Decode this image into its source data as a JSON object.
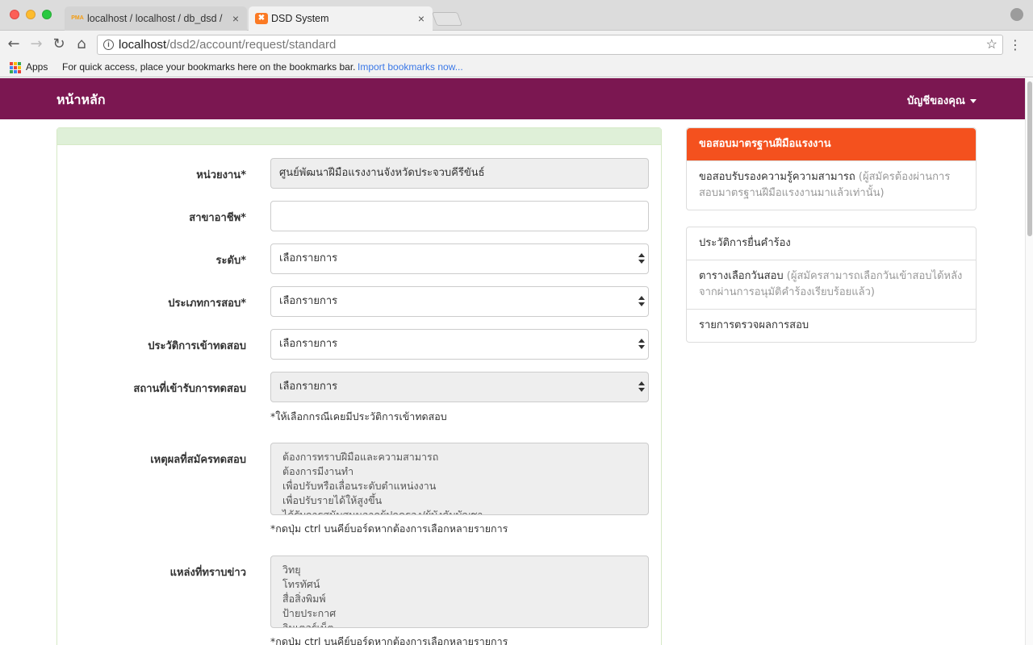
{
  "browser": {
    "tabs": [
      {
        "title": "localhost / localhost / db_dsd /",
        "favicon": "PMA",
        "close": "×"
      },
      {
        "title": "DSD System",
        "close": "×"
      }
    ],
    "url_host": "localhost",
    "url_path": "/dsd2/account/request/standard",
    "bookmarks": {
      "apps_label": "Apps",
      "hint": "For quick access, place your bookmarks here on the bookmarks bar.",
      "import_link": "Import bookmarks now..."
    }
  },
  "navbar": {
    "brand": "หน้าหลัก",
    "account_menu": "บัญชีของคุณ",
    "color": "#7b1751"
  },
  "form": {
    "agency": {
      "label": "หน่วยงาน*",
      "value": "ศูนย์พัฒนาฝีมือแรงงานจังหวัดประจวบคีรีขันธ์"
    },
    "career": {
      "label": "สาขาอาชีพ*",
      "value": ""
    },
    "level": {
      "label": "ระดับ*",
      "value": "เลือกรายการ"
    },
    "exam_type": {
      "label": "ประเภทการสอบ*",
      "value": "เลือกรายการ"
    },
    "exam_history": {
      "label": "ประวัติการเข้าทดสอบ",
      "value": "เลือกรายการ"
    },
    "exam_place": {
      "label": "สถานที่เข้ารับการทดสอบ",
      "value": "เลือกรายการ",
      "help": "*ให้เลือกกรณีเคยมีประวัติการเข้าทดสอบ"
    },
    "reason": {
      "label": "เหตุผลที่สมัครทดสอบ",
      "options": [
        "ต้องการทราบฝีมือและความสามารถ",
        "ต้องการมีงานทำ",
        "เพื่อปรับหรือเลื่อนระดับตำแหน่งงาน",
        "เพื่อปรับรายได้ให้สูงขึ้น",
        "ได้รับการสนับสนุนจากผู้ปกครอง/ผู้บังคับบัญชา"
      ],
      "help": "*กดปุ่ม ctrl บนคีย์บอร์ดหากต้องการเลือกหลายรายการ"
    },
    "news_source": {
      "label": "แหล่งที่ทราบข่าว",
      "options": [
        "วิทยุ",
        "โทรทัศน์",
        "สื่อสิ่งพิมพ์",
        "ป้ายประกาศ",
        "อินเตอร์เน็ต"
      ],
      "help": "*กดปุ่ม ctrl บนคีย์บอร์ดหากต้องการเลือกหลายรายการ"
    }
  },
  "sidebar": {
    "group1": [
      {
        "label": "ขอสอบมาตรฐานฝีมือแรงงาน",
        "note": "",
        "active": true
      },
      {
        "label": "ขอสอบรับรองความรู้ความสามารถ",
        "note": "(ผู้สมัครต้องผ่านการสอบมาตรฐานฝีมือแรงงานมาแล้วเท่านั้น)",
        "active": false
      }
    ],
    "group2": [
      {
        "label": "ประวัติการยื่นคำร้อง",
        "note": ""
      },
      {
        "label": "ตารางเลือกวันสอบ",
        "note": "(ผู้สมัครสามารถเลือกวันเข้าสอบได้หลังจากผ่านการอนุมัติคำร้องเรียบร้อยแล้ว)"
      },
      {
        "label": "รายการตรวจผลการสอบ",
        "note": ""
      }
    ],
    "active_color": "#f4511e"
  }
}
